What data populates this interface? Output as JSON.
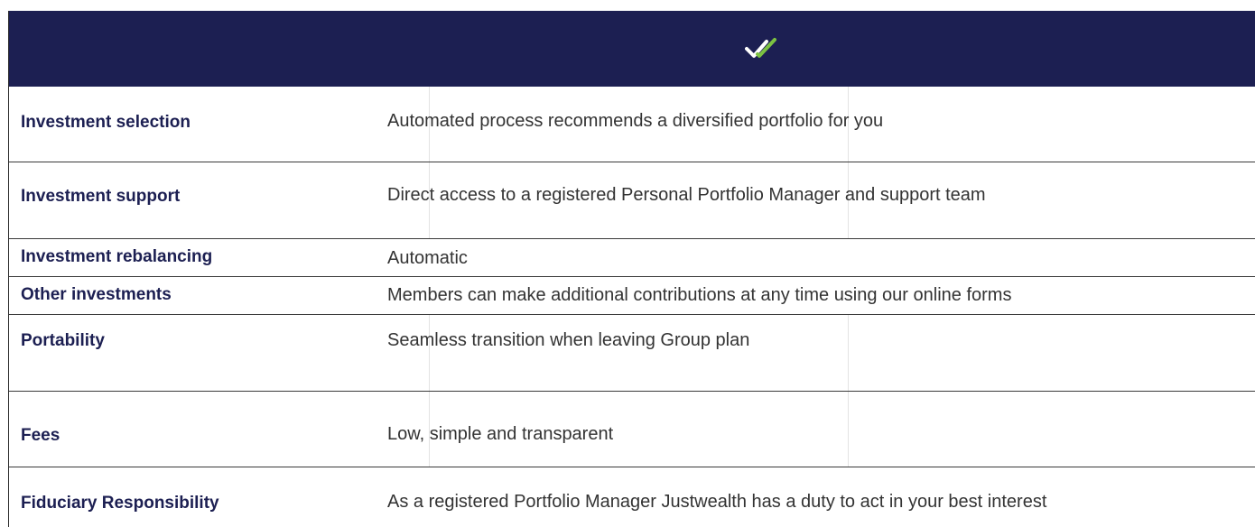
{
  "header": {
    "icon": "double-check-icon",
    "colors": {
      "background": "#1c1f52",
      "check_primary": "#ffffff",
      "check_accent": "#7cc242"
    }
  },
  "rows": [
    {
      "label": "Investment selection",
      "value": "Automated process recommends a diversified portfolio for you"
    },
    {
      "label": "Investment support",
      "value": "Direct access to a registered Personal Portfolio Manager and support team"
    },
    {
      "label": "Investment rebalancing",
      "value": "Automatic"
    },
    {
      "label": "Other investments",
      "value": "Members can make additional contributions at any time using our online forms"
    },
    {
      "label": "Portability",
      "value": "Seamless transition when leaving Group plan"
    },
    {
      "label": "Fees",
      "value": "Low, simple and transparent"
    },
    {
      "label": "Fiduciary Responsibility",
      "value": "As a registered Portfolio Manager Justwealth has a duty to act in your best interest"
    }
  ]
}
